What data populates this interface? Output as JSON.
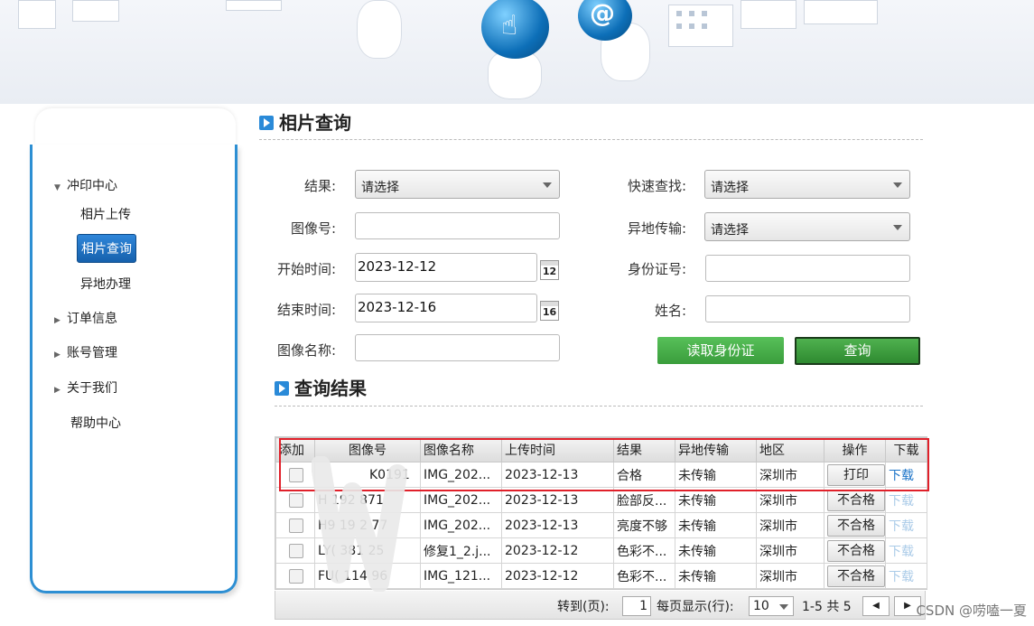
{
  "sidebar": {
    "items": [
      {
        "label": "冲印中心",
        "expanded": true
      },
      {
        "label": "相片上传"
      },
      {
        "label": "相片查询",
        "active": true
      },
      {
        "label": "异地办理"
      },
      {
        "label": "订单信息",
        "expanded": false
      },
      {
        "label": "账号管理",
        "expanded": false
      },
      {
        "label": "关于我们",
        "expanded": false
      },
      {
        "label": "帮助中心"
      }
    ]
  },
  "page_title": "相片查询",
  "form": {
    "result_label": "结果:",
    "result_value": "请选择",
    "quick_label": "快速查找:",
    "quick_value": "请选择",
    "image_no_label": "图像号:",
    "remote_label": "异地传输:",
    "remote_value": "请选择",
    "start_label": "开始时间:",
    "start_value": "2023-12-12",
    "start_cal": "12",
    "idcard_label": "身份证号:",
    "end_label": "结束时间:",
    "end_value": "2023-12-16",
    "end_cal": "16",
    "name_label": "姓名:",
    "image_name_label": "图像名称:",
    "read_id_button": "读取身份证",
    "query_button": "查询"
  },
  "results_title": "查询结果",
  "table": {
    "headers": [
      "添加",
      "图像号",
      "图像名称",
      "上传时间",
      "结果",
      "异地传输",
      "地区",
      "操作",
      "下载"
    ],
    "rows": [
      {
        "image_no": "K0191",
        "image_name": "IMG_202...",
        "time": "2023-12-13",
        "result": "合格",
        "remote": "未传输",
        "region": "深圳市",
        "action": "打印",
        "download": "下载",
        "download_enabled": true
      },
      {
        "image_no": "H 192  871",
        "image_name": "IMG_202...",
        "time": "2023-12-13",
        "result": "脸部反...",
        "remote": "未传输",
        "region": "深圳市",
        "action": "不合格",
        "download": "下载",
        "download_enabled": false
      },
      {
        "image_no": "H9 19  2 77",
        "image_name": "IMG_202...",
        "time": "2023-12-13",
        "result": "亮度不够",
        "remote": "未传输",
        "region": "深圳市",
        "action": "不合格",
        "download": "下载",
        "download_enabled": false
      },
      {
        "image_no": "LY(  381 25",
        "image_name": "修复1_2.j...",
        "time": "2023-12-12",
        "result": "色彩不...",
        "remote": "未传输",
        "region": "深圳市",
        "action": "不合格",
        "download": "下载",
        "download_enabled": false
      },
      {
        "image_no": "FU(  114 96",
        "image_name": "IMG_121...",
        "time": "2023-12-12",
        "result": "色彩不...",
        "remote": "未传输",
        "region": "深圳市",
        "action": "不合格",
        "download": "下载",
        "download_enabled": false
      }
    ]
  },
  "pager": {
    "goto_label": "转到(页):",
    "page_value": "1",
    "per_page_label": "每页显示(行):",
    "per_page_value": "10",
    "range_text": "1-5 共 5"
  },
  "watermark": "CSDN @唠嗑一夏",
  "colors": {
    "accent": "#2d8fd3",
    "green": "#3a9d3c",
    "highlight": "#e0202a",
    "link": "#1a73c8"
  }
}
